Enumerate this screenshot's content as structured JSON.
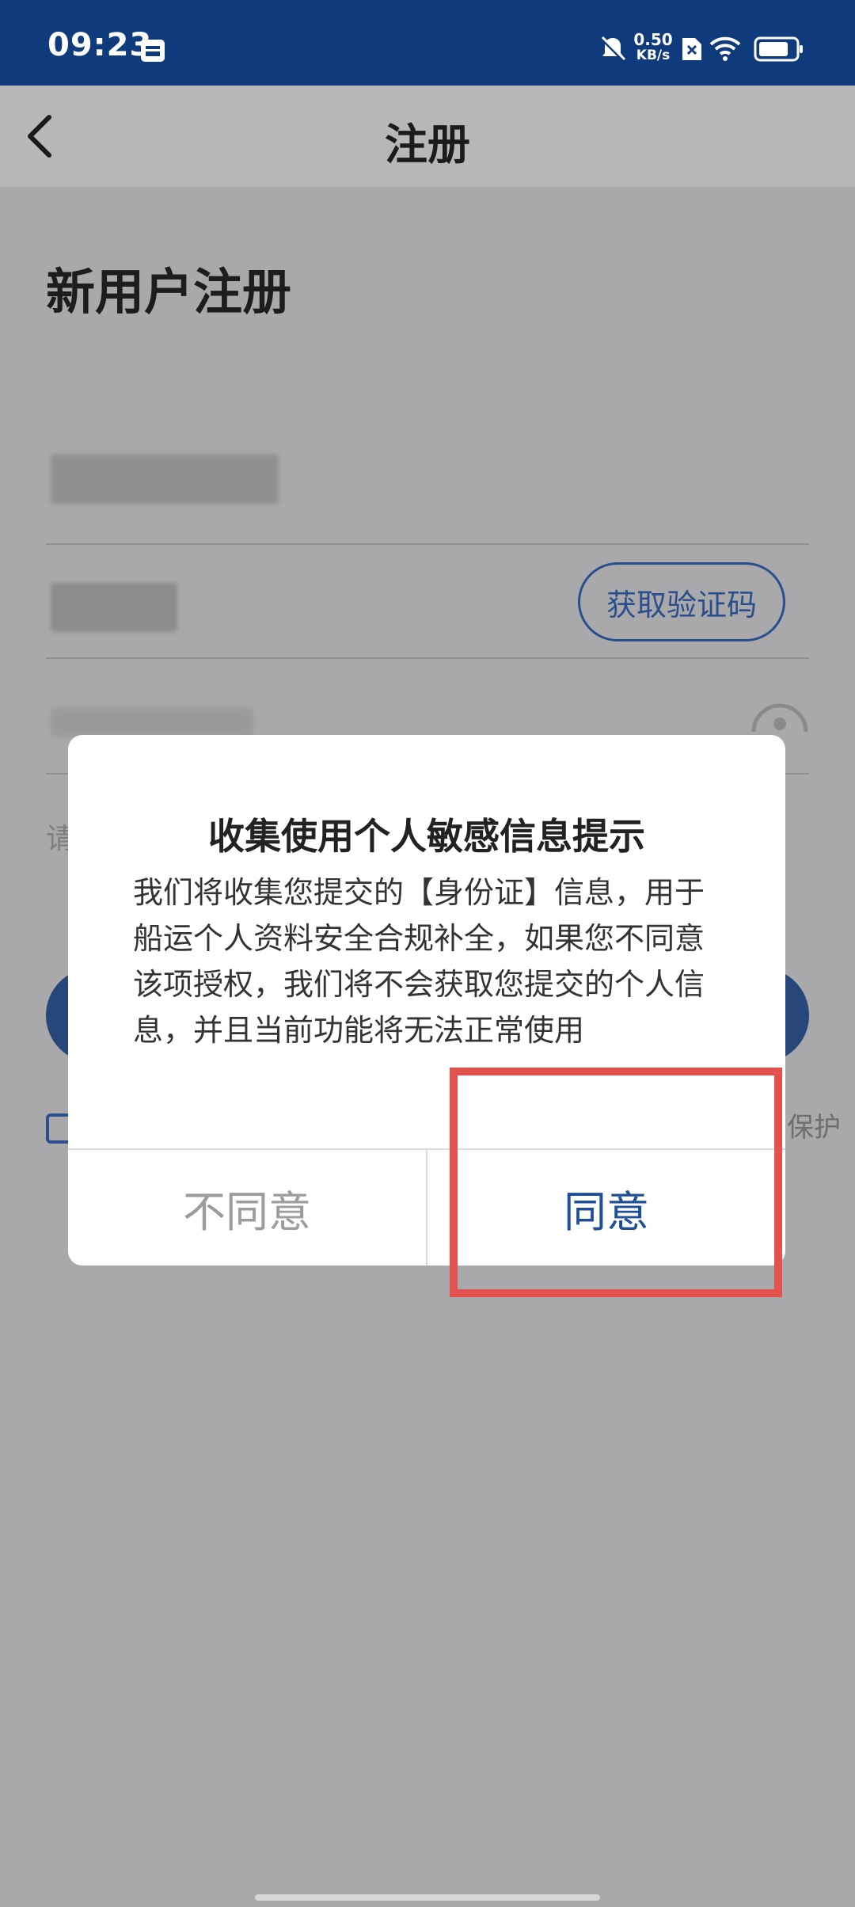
{
  "status_bar": {
    "time": "09:23",
    "net_speed_value": "0.50",
    "net_speed_unit": "KB/s"
  },
  "nav": {
    "title": "注册"
  },
  "page": {
    "heading": "新用户注册",
    "get_code_label": "获取验证码",
    "hint_fragment": "请",
    "protect_fragment": "保护"
  },
  "dialog": {
    "title": "收集使用个人敏感信息提示",
    "body": "我们将收集您提交的【身份证】信息，用于船运个人资料安全合规补全，如果您不同意该项授权，我们将不会获取您提交的个人信息，并且当前功能将无法正常使用",
    "disagree_label": "不同意",
    "agree_label": "同意"
  },
  "colors": {
    "status_bar": "#0f3a7c",
    "accent": "#1f4f97",
    "highlight": "#e3524e"
  }
}
